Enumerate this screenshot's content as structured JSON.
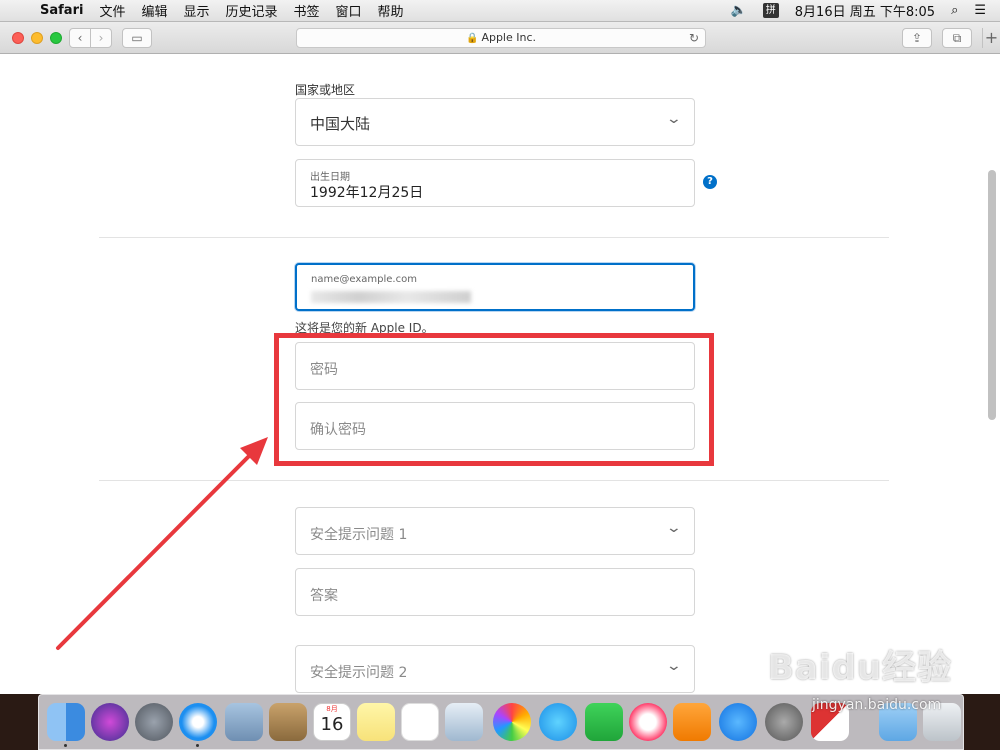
{
  "menubar": {
    "app": "Safari",
    "items": [
      "文件",
      "编辑",
      "显示",
      "历史记录",
      "书签",
      "窗口",
      "帮助"
    ],
    "ime": "拼",
    "datetime": "8月16日 周五 下午8:05"
  },
  "browser": {
    "url_label": "Apple Inc."
  },
  "form": {
    "country_label": "国家或地区",
    "country_value": "中国大陆",
    "dob_label": "出生日期",
    "dob_value": "1992年12月25日",
    "help_icon": "?",
    "email_placeholder": "name@example.com",
    "apple_id_note": "这将是您的新 Apple ID。",
    "password_placeholder": "密码",
    "confirm_password_placeholder": "确认密码",
    "security_q1": "安全提示问题 1",
    "answer_placeholder": "答案",
    "security_q2": "安全提示问题 2"
  },
  "annotation": {
    "highlight_color": "#e8383d"
  },
  "watermark": {
    "brand": "Baidu经验",
    "url": "jingyan.baidu.com"
  },
  "dock": {
    "calendar_day": "16",
    "calendar_month": "8月"
  },
  "colors": {
    "accent": "#0070c9",
    "secure_lock": "#2fa843"
  }
}
